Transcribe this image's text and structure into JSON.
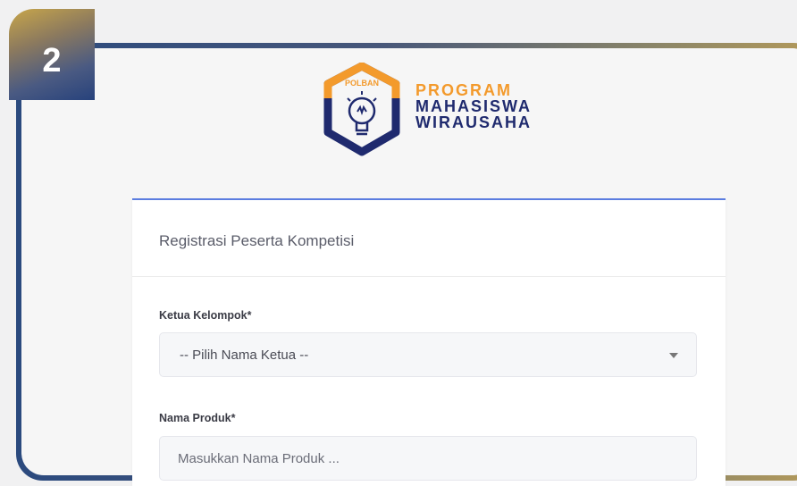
{
  "step": {
    "number": "2"
  },
  "brand": {
    "badge_text": "POLBAN",
    "line1": "PROGRAM",
    "line2": "MAHASISWA",
    "line3": "WIRAUSAHA"
  },
  "form": {
    "title": "Registrasi Peserta Kompetisi",
    "leader_label": "Ketua Kelompok*",
    "leader_selected": "-- Pilih Nama Ketua --",
    "product_label": "Nama Produk*",
    "product_placeholder": "Masukkan Nama Produk ..."
  },
  "colors": {
    "accent": "#5b7de0",
    "brand_orange": "#f39a2c",
    "brand_navy": "#1f2a6e"
  }
}
